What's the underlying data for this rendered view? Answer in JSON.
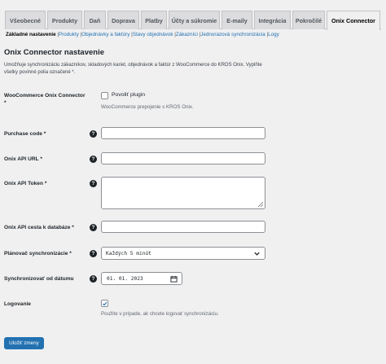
{
  "tabs": [
    {
      "label": "Všeobecné",
      "active": false
    },
    {
      "label": "Produkty",
      "active": false
    },
    {
      "label": "Daň",
      "active": false
    },
    {
      "label": "Doprava",
      "active": false
    },
    {
      "label": "Platby",
      "active": false
    },
    {
      "label": "Účty a súkromie",
      "active": false
    },
    {
      "label": "E-maily",
      "active": false
    },
    {
      "label": "Integrácia",
      "active": false
    },
    {
      "label": "Pokročilé",
      "active": false
    },
    {
      "label": "Onix Connector",
      "active": true
    }
  ],
  "subnav": {
    "current": "Základné nastavenie",
    "links": [
      "Produkty",
      "Objednávky a faktúry",
      "Stavy objednávok",
      "Zákazníci",
      "Jednorazová synchronizácia",
      "Logy"
    ],
    "separator": "|"
  },
  "page": {
    "title": "Onix Connector nastavenie",
    "description": "Umožňuje synchronizáciu zákazníkov, skladových kariet, objednávok a faktúr z WooCommerce do KROS Onix. Vyplňte všetky povinné polia označené *."
  },
  "form": {
    "connector": {
      "label": "WooCommerce Onix Connector *",
      "checkbox_label": "Povoliť plugin",
      "checked": false,
      "note": "WooCommerce prepojenie s KROS Onix."
    },
    "purchase_code": {
      "label": "Purchase code *",
      "value": ""
    },
    "api_url": {
      "label": "Onix API URL *",
      "value": ""
    },
    "api_token": {
      "label": "Onix API Token *",
      "value": ""
    },
    "db_path": {
      "label": "Onix API cesta k databáze *",
      "value": ""
    },
    "scheduler": {
      "label": "Plánovač synchronizácie *",
      "selected": "Každých 5 minút"
    },
    "sync_from": {
      "label": "Synchronizovať od dátumu",
      "value": "01. 01. 2023"
    },
    "logging": {
      "label": "Logovanie",
      "checked": true,
      "note": "Použite v prípade, ak chcete logovať synchronizáciu."
    },
    "help_glyph": "?"
  },
  "save_button": "Uložiť zmeny",
  "colors": {
    "accent": "#2271b1",
    "background": "#f0f0f1",
    "tab_bg": "#dcdcde"
  }
}
